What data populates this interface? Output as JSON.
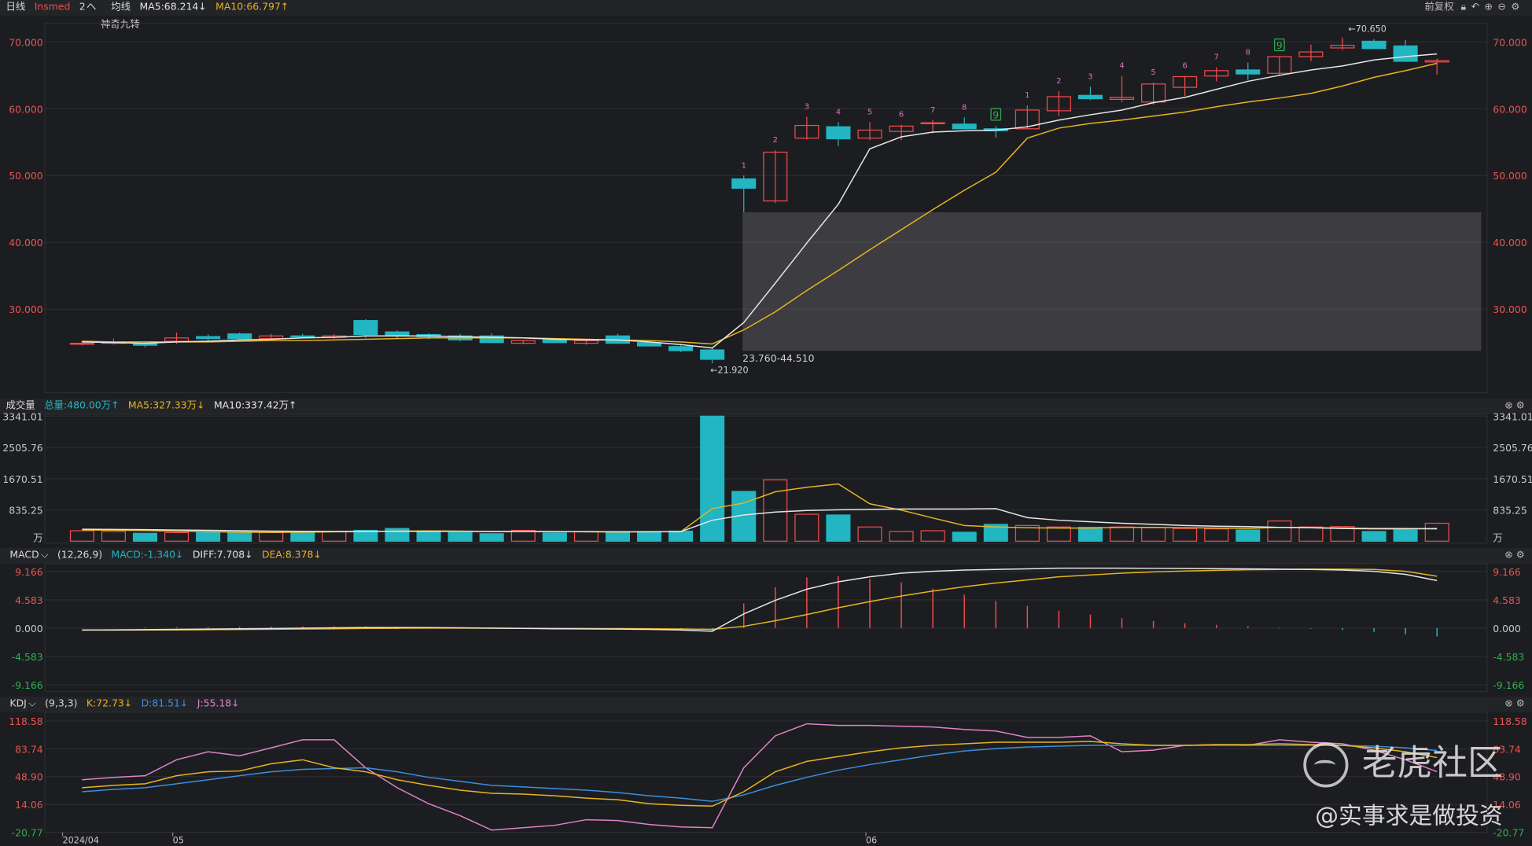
{
  "header": {
    "period": "日线",
    "symbol": "Insmed",
    "count": "2",
    "caret": "へ",
    "ma_label": "均线",
    "ma5": "MA5:68.214↓",
    "ma10": "MA10:66.797↑",
    "indicator_sub": "神奇九转",
    "adjust": "前复权"
  },
  "colors": {
    "up": "#ef4b4b",
    "down": "#22b5c2",
    "ma5": "#e6e6e6",
    "ma10": "#e6b422",
    "bg": "#1c1d20",
    "grid": "#2c2d31",
    "label_red": "#e85454",
    "label_green": "#2fb04e"
  },
  "price_panel": {
    "y_ticks": [
      "70.000",
      "60.000",
      "50.000",
      "40.000",
      "30.000"
    ],
    "high_mark": "←70.650",
    "low_mark": "←21.920",
    "gap_label": "23.760-44.510"
  },
  "volume_panel": {
    "title": "成交量",
    "total": "总量:480.00万↑",
    "ma5": "MA5:327.33万↓",
    "ma10": "MA10:337.42万↑",
    "y_ticks": [
      "3341.01",
      "2505.76",
      "1670.51",
      "835.25",
      "万"
    ]
  },
  "macd_panel": {
    "title": "MACD",
    "params": "(12,26,9)",
    "macd": "MACD:-1.340↓",
    "diff": "DIFF:7.708↓",
    "dea": "DEA:8.378↓",
    "y_ticks": [
      "9.166",
      "4.583",
      "0.000",
      "-4.583",
      "-9.166"
    ]
  },
  "kdj_panel": {
    "title": "KDJ",
    "params": "(9,3,3)",
    "k": "K:72.73↓",
    "d": "D:81.51↓",
    "j": "J:55.18↓",
    "y_ticks": [
      "118.58",
      "83.74",
      "48.90",
      "14.06",
      "-20.77"
    ]
  },
  "x_axis": [
    "2024/04",
    "05",
    "06"
  ],
  "watermark": {
    "brand": "老虎社区",
    "handle": "@实事求是做投资"
  },
  "chart_data": {
    "type": "candlestick",
    "candles": [
      {
        "o": 24.9,
        "h": 25.2,
        "l": 24.6,
        "c": 24.9
      },
      {
        "o": 24.9,
        "h": 25.6,
        "l": 24.7,
        "c": 25.1
      },
      {
        "o": 24.9,
        "h": 25.2,
        "l": 24.3,
        "c": 24.6
      },
      {
        "o": 25.2,
        "h": 26.5,
        "l": 24.8,
        "c": 25.7
      },
      {
        "o": 25.9,
        "h": 26.2,
        "l": 25.3,
        "c": 25.6
      },
      {
        "o": 26.3,
        "h": 26.5,
        "l": 25.3,
        "c": 25.6
      },
      {
        "o": 25.6,
        "h": 26.3,
        "l": 25.3,
        "c": 26.0
      },
      {
        "o": 26.0,
        "h": 26.3,
        "l": 25.7,
        "c": 25.9
      },
      {
        "o": 25.8,
        "h": 26.3,
        "l": 25.6,
        "c": 26.0
      },
      {
        "o": 28.3,
        "h": 28.5,
        "l": 25.7,
        "c": 26.2
      },
      {
        "o": 26.6,
        "h": 26.8,
        "l": 25.6,
        "c": 26.0
      },
      {
        "o": 26.2,
        "h": 26.4,
        "l": 25.5,
        "c": 25.9
      },
      {
        "o": 26.0,
        "h": 26.3,
        "l": 25.2,
        "c": 25.4
      },
      {
        "o": 26.0,
        "h": 26.4,
        "l": 24.9,
        "c": 25.0
      },
      {
        "o": 24.9,
        "h": 25.4,
        "l": 24.8,
        "c": 25.3
      },
      {
        "o": 25.4,
        "h": 25.7,
        "l": 24.9,
        "c": 25.0
      },
      {
        "o": 24.9,
        "h": 25.5,
        "l": 24.7,
        "c": 25.3
      },
      {
        "o": 26.0,
        "h": 26.3,
        "l": 24.8,
        "c": 24.9
      },
      {
        "o": 25.0,
        "h": 25.2,
        "l": 24.4,
        "c": 24.5
      },
      {
        "o": 24.4,
        "h": 24.6,
        "l": 23.6,
        "c": 23.8
      },
      {
        "o": 23.9,
        "h": 24.2,
        "l": 21.92,
        "c": 22.5
      },
      {
        "o": 49.5,
        "h": 50.0,
        "l": 44.51,
        "c": 48.1
      },
      {
        "o": 46.2,
        "h": 53.8,
        "l": 45.9,
        "c": 53.5
      },
      {
        "o": 55.6,
        "h": 58.8,
        "l": 55.4,
        "c": 57.5
      },
      {
        "o": 57.3,
        "h": 58.0,
        "l": 54.4,
        "c": 55.5
      },
      {
        "o": 55.6,
        "h": 58.0,
        "l": 55.3,
        "c": 56.8
      },
      {
        "o": 56.6,
        "h": 57.6,
        "l": 55.3,
        "c": 57.4
      },
      {
        "o": 57.8,
        "h": 58.3,
        "l": 56.3,
        "c": 57.9
      },
      {
        "o": 57.7,
        "h": 58.7,
        "l": 57.0,
        "c": 57.0
      },
      {
        "o": 57.0,
        "h": 57.4,
        "l": 55.7,
        "c": 56.7
      },
      {
        "o": 57.0,
        "h": 60.5,
        "l": 57.0,
        "c": 59.8
      },
      {
        "o": 59.7,
        "h": 62.6,
        "l": 58.9,
        "c": 61.8
      },
      {
        "o": 62.0,
        "h": 63.3,
        "l": 61.3,
        "c": 61.5
      },
      {
        "o": 61.4,
        "h": 64.9,
        "l": 61.0,
        "c": 61.7
      },
      {
        "o": 61.0,
        "h": 63.9,
        "l": 60.6,
        "c": 63.7
      },
      {
        "o": 63.2,
        "h": 64.9,
        "l": 61.9,
        "c": 64.8
      },
      {
        "o": 64.9,
        "h": 66.2,
        "l": 64.1,
        "c": 65.7
      },
      {
        "o": 65.8,
        "h": 66.9,
        "l": 64.3,
        "c": 65.2
      },
      {
        "o": 65.3,
        "h": 67.8,
        "l": 64.9,
        "c": 67.8
      },
      {
        "o": 67.8,
        "h": 69.6,
        "l": 67.1,
        "c": 68.5
      },
      {
        "o": 69.1,
        "h": 70.65,
        "l": 68.8,
        "c": 69.5
      },
      {
        "o": 70.1,
        "h": 70.4,
        "l": 69.0,
        "c": 69.0
      },
      {
        "o": 69.4,
        "h": 70.3,
        "l": 67.0,
        "c": 67.1
      },
      {
        "o": 67.0,
        "h": 67.5,
        "l": 65.1,
        "c": 67.2
      }
    ],
    "ma5": [
      25.1,
      25.0,
      24.9,
      25.1,
      25.2,
      25.4,
      25.5,
      25.7,
      25.8,
      26.0,
      26.0,
      26.0,
      25.9,
      25.8,
      25.7,
      25.5,
      25.4,
      25.4,
      25.1,
      24.7,
      24.2,
      28.0,
      33.9,
      39.9,
      45.7,
      54.0,
      55.8,
      56.5,
      56.7,
      56.8,
      57.3,
      58.3,
      59.1,
      59.8,
      60.9,
      61.7,
      62.9,
      64.1,
      65.0,
      65.8,
      66.4,
      67.3,
      67.8,
      68.2
    ],
    "ma10": [
      25.2,
      25.1,
      25.1,
      25.1,
      25.1,
      25.2,
      25.3,
      25.3,
      25.4,
      25.5,
      25.6,
      25.7,
      25.7,
      25.7,
      25.7,
      25.6,
      25.5,
      25.4,
      25.3,
      25.1,
      24.8,
      26.9,
      29.6,
      32.8,
      35.8,
      38.9,
      41.9,
      44.9,
      47.8,
      50.5,
      55.6,
      57.1,
      57.8,
      58.3,
      58.9,
      59.5,
      60.3,
      61.0,
      61.6,
      62.3,
      63.4,
      64.7,
      65.7,
      66.8
    ],
    "td_labels": [
      {
        "i": 21,
        "t": "1"
      },
      {
        "i": 22,
        "t": "2"
      },
      {
        "i": 23,
        "t": "3"
      },
      {
        "i": 24,
        "t": "4"
      },
      {
        "i": 25,
        "t": "5"
      },
      {
        "i": 26,
        "t": "6"
      },
      {
        "i": 27,
        "t": "7"
      },
      {
        "i": 28,
        "t": "8"
      },
      {
        "i": 29,
        "t": "9",
        "box": true
      },
      {
        "i": 30,
        "t": "1"
      },
      {
        "i": 31,
        "t": "2"
      },
      {
        "i": 32,
        "t": "3"
      },
      {
        "i": 33,
        "t": "4"
      },
      {
        "i": 34,
        "t": "5"
      },
      {
        "i": 35,
        "t": "6"
      },
      {
        "i": 36,
        "t": "7"
      },
      {
        "i": 37,
        "t": "8"
      },
      {
        "i": 38,
        "t": "9",
        "box": true
      }
    ],
    "volume": [
      280,
      260,
      210,
      230,
      240,
      250,
      230,
      220,
      260,
      290,
      340,
      260,
      230,
      200,
      290,
      220,
      260,
      260,
      260,
      270,
      3341,
      1330,
      1640,
      720,
      700,
      380,
      260,
      280,
      240,
      450,
      420,
      380,
      370,
      380,
      360,
      340,
      330,
      300,
      540,
      380,
      390,
      260,
      300,
      480
    ],
    "vol_ma5": [
      300,
      295,
      285,
      270,
      255,
      240,
      235,
      240,
      250,
      260,
      270,
      275,
      270,
      260,
      265,
      260,
      250,
      245,
      255,
      255,
      870,
      1020,
      1320,
      1440,
      1530,
      1000,
      830,
      620,
      420,
      380,
      360,
      350,
      350,
      370,
      370,
      360,
      350,
      340,
      370,
      360,
      350,
      340,
      340,
      327
    ],
    "vol_ma10": [
      320,
      315,
      310,
      300,
      290,
      280,
      270,
      265,
      260,
      265,
      265,
      265,
      265,
      260,
      260,
      258,
      255,
      250,
      250,
      255,
      560,
      700,
      780,
      820,
      840,
      850,
      860,
      860,
      860,
      870,
      630,
      560,
      520,
      480,
      450,
      420,
      400,
      390,
      370,
      360,
      340,
      330,
      330,
      337
    ],
    "diff": [
      -0.3,
      -0.28,
      -0.25,
      -0.2,
      -0.15,
      -0.1,
      -0.05,
      0.0,
      0.05,
      0.1,
      0.1,
      0.08,
      0.05,
      0.0,
      -0.05,
      -0.1,
      -0.12,
      -0.15,
      -0.2,
      -0.3,
      -0.5,
      2.3,
      4.5,
      6.3,
      7.5,
      8.3,
      8.9,
      9.2,
      9.4,
      9.5,
      9.6,
      9.7,
      9.7,
      9.7,
      9.68,
      9.65,
      9.62,
      9.6,
      9.55,
      9.5,
      9.4,
      9.2,
      8.7,
      7.7
    ],
    "dea": [
      -0.32,
      -0.31,
      -0.3,
      -0.28,
      -0.25,
      -0.22,
      -0.18,
      -0.14,
      -0.1,
      -0.05,
      -0.02,
      0.0,
      0.0,
      -0.01,
      -0.02,
      -0.04,
      -0.06,
      -0.08,
      -0.1,
      -0.14,
      -0.2,
      0.3,
      1.2,
      2.2,
      3.3,
      4.3,
      5.2,
      6.0,
      6.7,
      7.3,
      7.8,
      8.3,
      8.6,
      8.9,
      9.1,
      9.25,
      9.35,
      9.45,
      9.5,
      9.55,
      9.55,
      9.5,
      9.2,
      8.4
    ],
    "macd_hist": [
      0.04,
      0.06,
      0.1,
      0.16,
      0.2,
      0.24,
      0.26,
      0.28,
      0.3,
      0.3,
      0.24,
      0.16,
      0.1,
      0.02,
      -0.06,
      -0.12,
      -0.12,
      -0.14,
      -0.2,
      -0.32,
      -0.6,
      4.0,
      6.6,
      8.2,
      8.4,
      8.0,
      7.4,
      6.4,
      5.4,
      4.4,
      3.6,
      2.8,
      2.2,
      1.6,
      1.16,
      0.8,
      0.54,
      0.3,
      0.1,
      -0.1,
      -0.3,
      -0.6,
      -1.0,
      -1.34
    ],
    "kdj_k": [
      35,
      38,
      40,
      50,
      55,
      56,
      65,
      70,
      60,
      55,
      45,
      38,
      32,
      28,
      27,
      25,
      22,
      20,
      15,
      13,
      12,
      30,
      55,
      68,
      74,
      80,
      85,
      88,
      90,
      92,
      92,
      92,
      93,
      90,
      88,
      88,
      89,
      89,
      90,
      89,
      88,
      85,
      80,
      72.73
    ],
    "kdj_d": [
      30,
      33,
      35,
      40,
      45,
      50,
      55,
      58,
      59,
      60,
      55,
      48,
      43,
      38,
      36,
      34,
      32,
      29,
      25,
      22,
      18,
      26,
      38,
      48,
      57,
      64,
      70,
      76,
      81,
      84,
      86,
      87,
      88,
      88,
      88,
      88,
      88,
      88,
      88,
      88,
      88,
      87,
      85,
      81.51
    ],
    "kdj_j": [
      45,
      48,
      50,
      70,
      80,
      75,
      85,
      95,
      95,
      60,
      35,
      15,
      0,
      -18,
      -15,
      -12,
      -5,
      -6,
      -11,
      -14,
      -15,
      60,
      100,
      115,
      113,
      113,
      112,
      111,
      108,
      106,
      98,
      98,
      100,
      80,
      82,
      88,
      89,
      88,
      95,
      92,
      90,
      82,
      70,
      55.18
    ]
  }
}
